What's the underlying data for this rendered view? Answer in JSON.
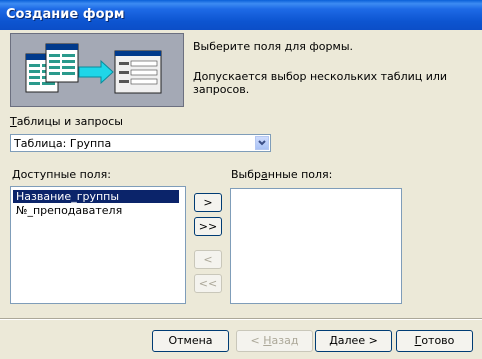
{
  "window": {
    "title": "Создание форм"
  },
  "header": {
    "prompt": "Выберите поля для формы.",
    "note": "Допускается выбор нескольких таблиц или запросов."
  },
  "source": {
    "label_hotkey": "Т",
    "label_rest": "аблицы и запросы",
    "value": "Таблица: Группа",
    "dropdown_icon": "chevron-down-icon"
  },
  "available": {
    "label_hotkey": "Д",
    "label_rest": "оступные поля:",
    "items": [
      "Название_группы",
      "№_преподавателя"
    ],
    "selected_index": 0
  },
  "selected": {
    "label_prefix": "Выбр",
    "label_hotkey": "а",
    "label_rest": "нные поля:",
    "items": []
  },
  "move_buttons": {
    "add_one": ">",
    "add_all": ">>",
    "remove_one": "<",
    "remove_all": "<<"
  },
  "footer": {
    "cancel": "Отмена",
    "back_prefix": "< ",
    "back_hotkey": "Н",
    "back_rest": "азад",
    "next_hotkey": "Д",
    "next_rest": "алее >",
    "finish_hotkey": "Г",
    "finish_rest": "отово"
  },
  "colors": {
    "titlebar": "#0b4ec8",
    "selection": "#0b246a",
    "dialog_bg": "#ece9d8"
  }
}
